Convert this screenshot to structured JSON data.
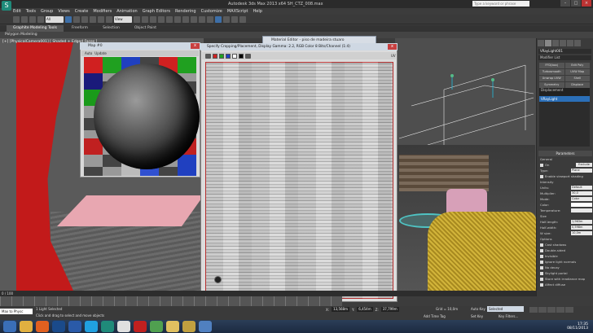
{
  "window": {
    "title": "Autodesk 3ds Max 2013 x64      SH_CTZ_008.max",
    "search_placeholder": "Type a keyword or phrase",
    "logo_glyph": "S"
  },
  "menu": [
    "Edit",
    "Tools",
    "Group",
    "Views",
    "Create",
    "Modifiers",
    "Animation",
    "Graph Editors",
    "Rendering",
    "Customize",
    "MAXScript",
    "Help"
  ],
  "toolbar": {
    "selection_set": "All",
    "view_dropdown": "View"
  },
  "ribbon": {
    "tabs": [
      "Graphite Modeling Tools",
      "Freeform",
      "Selection",
      "Object Paint"
    ],
    "active_tab": 0,
    "subtitle": "Polygon Modeling"
  },
  "viewport_left": {
    "label": "[+] [PhysicalCamera001] [ Shaded + Edged Faces ]"
  },
  "map_window": {
    "title": "Map #0",
    "tools": [
      "Auto",
      "Update"
    ],
    "close": "x"
  },
  "material_editor_bar": {
    "title": "Material Editor - piso de madeira stuaro"
  },
  "specify_window": {
    "title": "Specify Cropping/Placement, Display Gamma: 2.2, RGB Color 8 Bits/Channel (1:4)",
    "tools_label": "UV",
    "close": "x",
    "swatch_colors": [
      "#d02020",
      "#20a020",
      "#2040c0",
      "#ffffff",
      "#000000"
    ]
  },
  "right_panel": {
    "object_name": "VRayLight001",
    "modifier_list": "Modifier List",
    "buttons": [
      "FFD(box)",
      "Edit Poly",
      "Turbosmooth",
      "UVW Map",
      "Unwrap UVW",
      "Shell",
      "Symmetry",
      "Displace"
    ],
    "stack_header": "Displacement",
    "stack_item": "VRayLight",
    "params_header": "Parameters",
    "general_header": "General",
    "on_label": "On",
    "exclude_label": "Exclude",
    "type_label": "Type:",
    "type_value": "Plane",
    "enable_vp": "Enable viewport shading",
    "intensity_header": "Intensity",
    "units_label": "Units:",
    "units_value": "Default (image)",
    "multiplier_label": "Multiplier:",
    "multiplier_value": "30,0",
    "mode_label": "Mode:",
    "mode_value": "Color",
    "color_label": "Color:",
    "temperature_label": "Temperature:",
    "size_header": "Size",
    "half_length_label": "Half-length:",
    "half_length_value": "1,963m",
    "half_width_label": "Half-width:",
    "half_width_value": "0,598m",
    "w_size_label": "W size:",
    "w_size_value": "10,0m",
    "options_header": "Options",
    "options": [
      "Cast shadows",
      "Double-sided",
      "Invisible",
      "Ignore light normals",
      "No decay",
      "Skylight portal",
      "Store with irradiance map",
      "Affect diffuse"
    ]
  },
  "timeline": {
    "frame": "0 / 100"
  },
  "status": {
    "script_box": "Max to Physc",
    "msg1": "1 Light Selected",
    "msg2": "Click and drag to select and move objects",
    "x_label": "X:",
    "x_value": "13,568m",
    "y_label": "Y:",
    "y_value": "6,454m",
    "z_label": "Z:",
    "z_value": "37,799m",
    "grid": "Grid = 10,0m",
    "add_time_tag": "Add Time Tag",
    "auto_key": "Auto Key",
    "set_key": "Set Key",
    "selected": "Selected",
    "key_filters": "Key Filters..."
  },
  "taskbar": {
    "icons": [
      "start-orb-icon",
      "explorer-icon",
      "firefox-icon",
      "photoshop-icon",
      "word-icon",
      "skype-icon",
      "3dsmax-icon",
      "vray-icon",
      "pdf-icon",
      "chrome-icon",
      "folder-icon",
      "paint-icon",
      "media-icon"
    ],
    "icon_colors": [
      "#3a6fb8",
      "#e0b040",
      "#e06020",
      "#1a4a8a",
      "#2a5aa8",
      "#20a0e0",
      "#1f8a7a",
      "#e0e0e0",
      "#c02020",
      "#50a050",
      "#e0c060",
      "#c0a040",
      "#5080c0"
    ],
    "time": "17:35",
    "date": "08/11/2013"
  }
}
